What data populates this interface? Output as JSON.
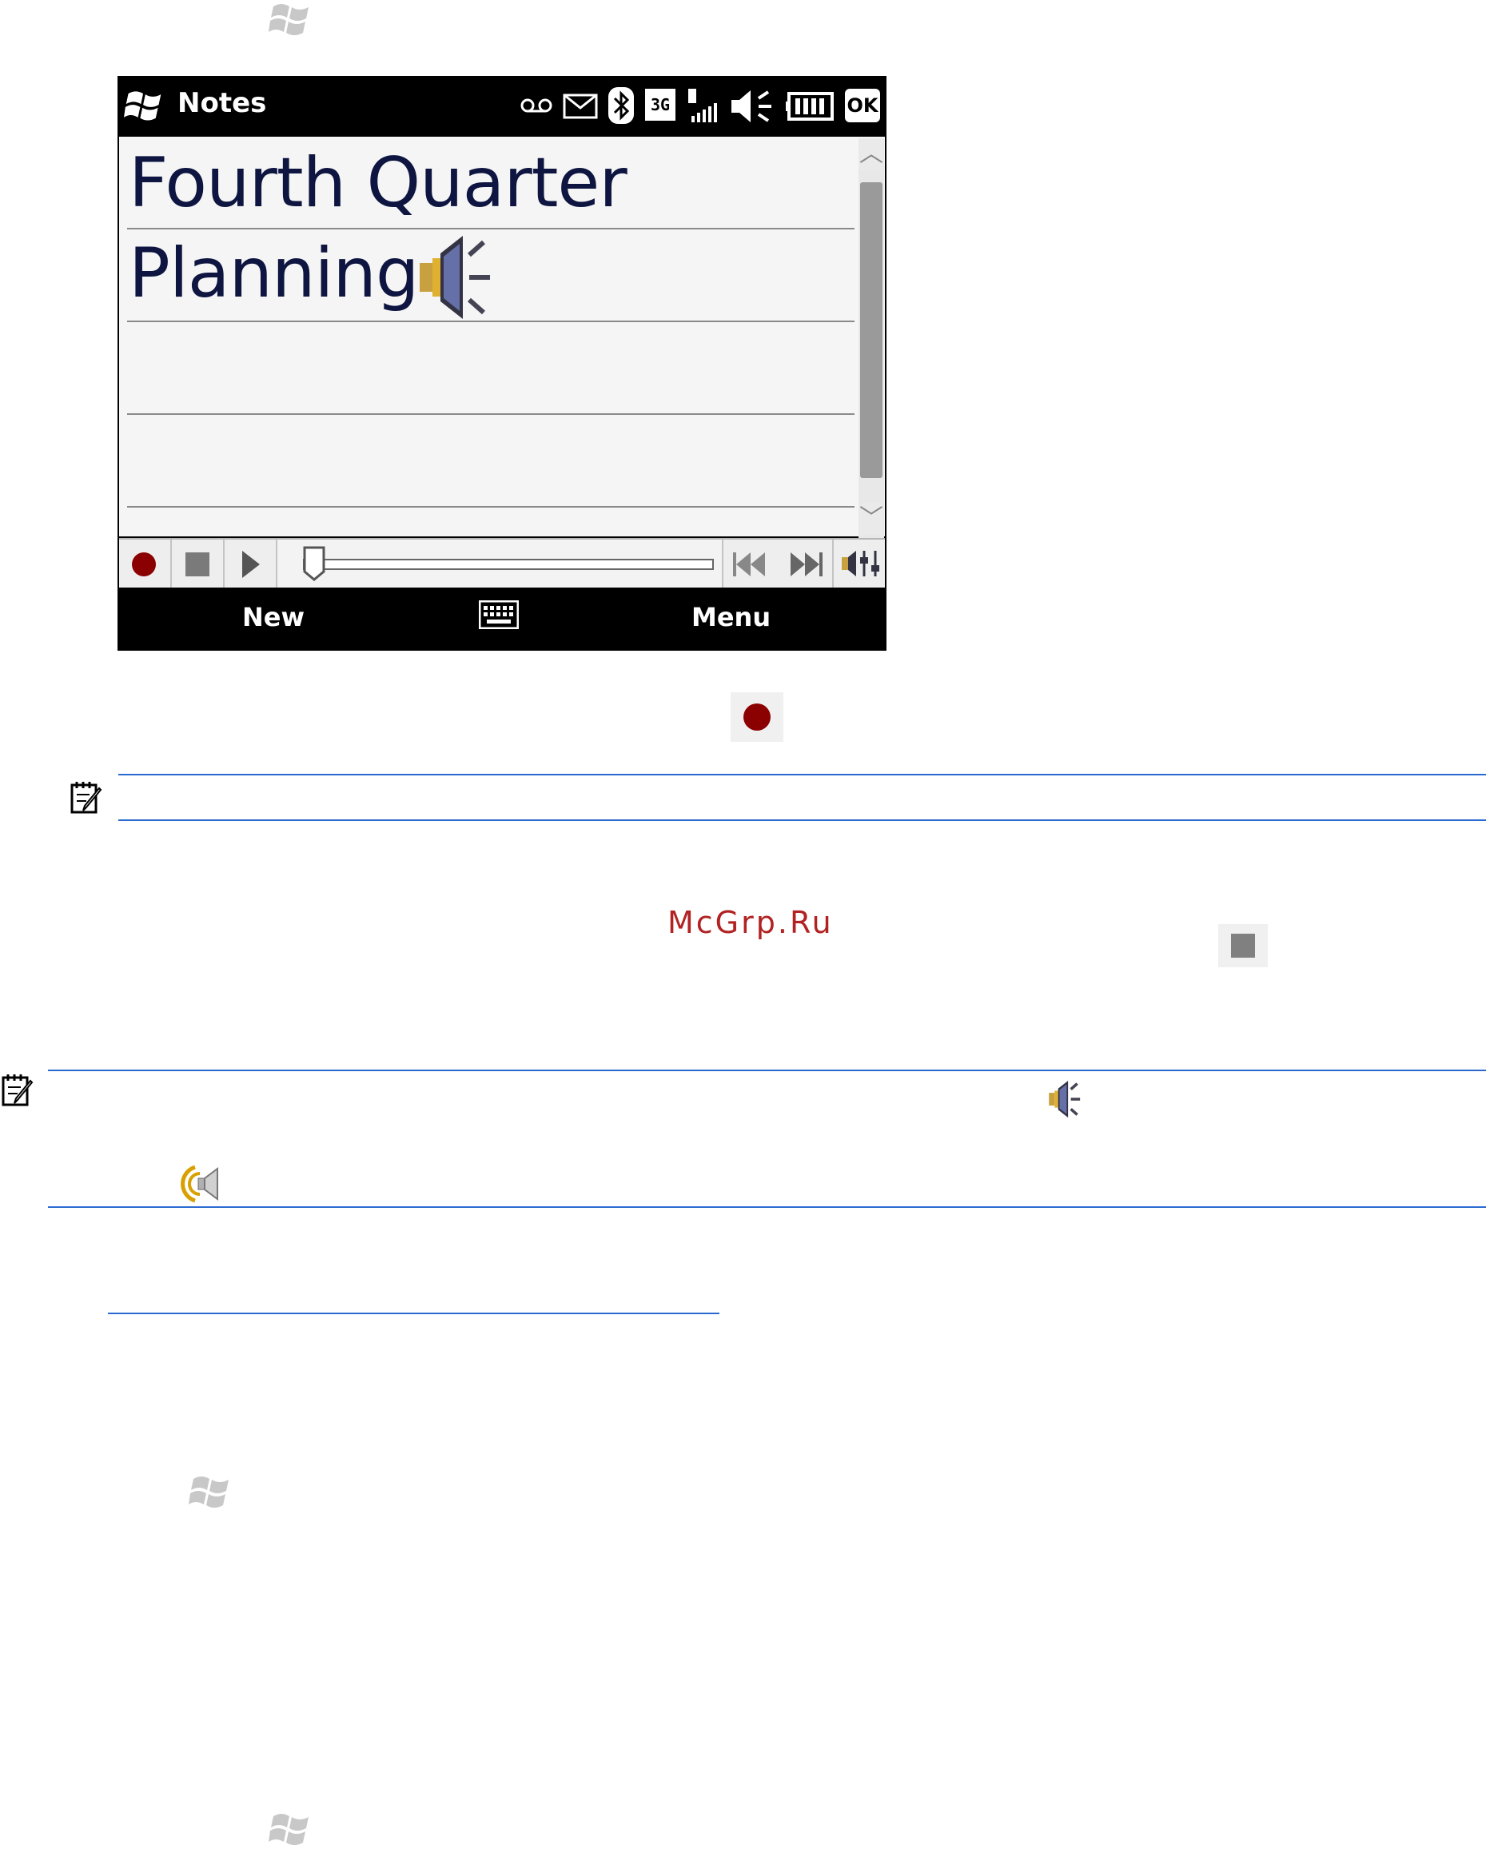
{
  "phone": {
    "app_title": "Notes",
    "note_lines": [
      "Fourth Quarter",
      "Planning"
    ],
    "softkeys": {
      "left": "New",
      "right": "Menu",
      "status_ok": "OK",
      "network": "3G"
    }
  },
  "watermark": "McGrp.Ru",
  "colors": {
    "record_red": "#8b0000",
    "link_blue": "#2a6ad0",
    "note_text": "#0d1540"
  }
}
